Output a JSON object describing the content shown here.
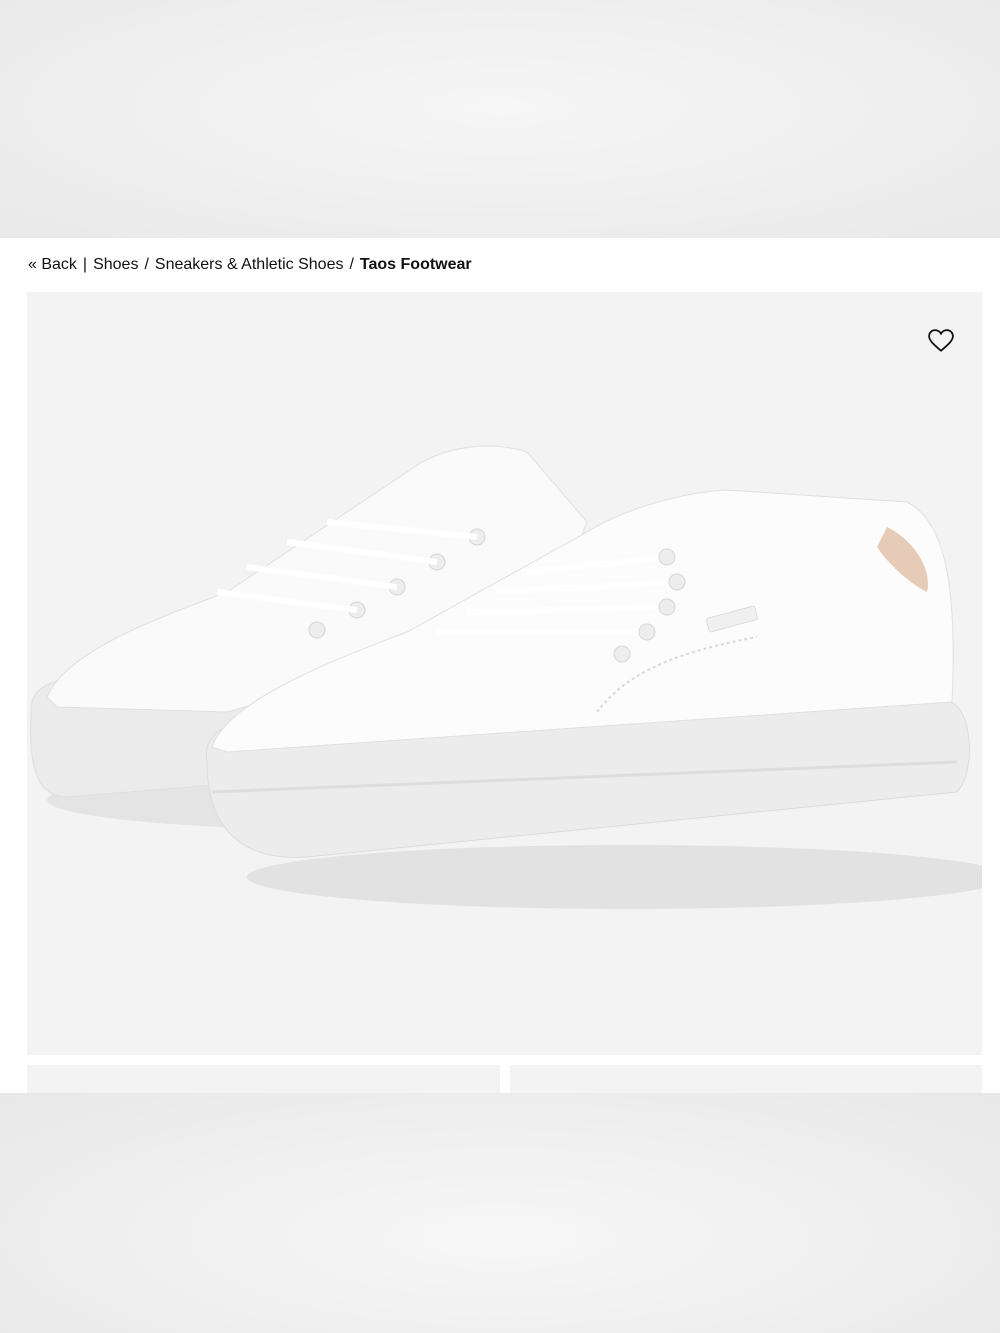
{
  "breadcrumb": {
    "back_label": "« Back",
    "divider": "|",
    "items": [
      "Shoes",
      "Sneakers & Athletic Shoes"
    ],
    "current": "Taos Footwear",
    "separator": "/"
  },
  "product": {
    "image_alt": "White leather low-top lace-up sneakers",
    "favorite_icon": "heart-outline-icon"
  },
  "colors": {
    "gallery_bg": "#f3f3f3",
    "text": "#111111"
  }
}
